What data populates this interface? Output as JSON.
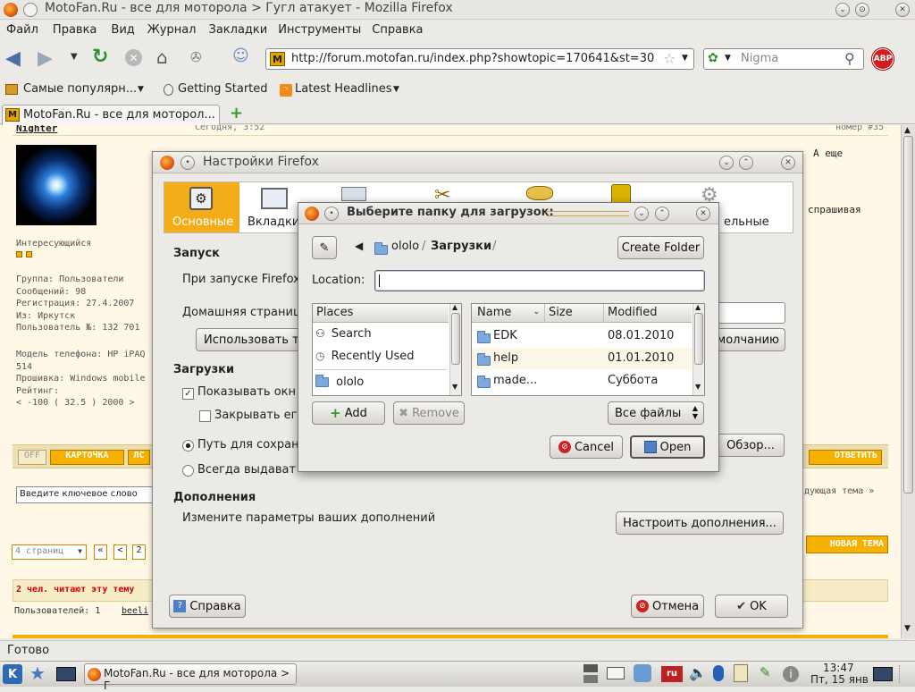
{
  "window_title": "MotoFan.Ru - все для моторола > Гугл атакует - Mozilla Firefox",
  "menu": [
    "Файл",
    "Правка",
    "Вид",
    "Журнал",
    "Закладки",
    "Инструменты",
    "Справка"
  ],
  "url": "http://forum.motofan.ru/index.php?showtopic=170641&st=30",
  "search_placeholder": "Nigma",
  "bookmarks": [
    "Самые популярн...",
    "Getting Started",
    "Latest Headlines"
  ],
  "tab_title": "MotoFan.Ru - все для моторол...",
  "status": "Готово",
  "forum": {
    "user": "Nighter",
    "post_time": "Сегодня, 3:52",
    "post_number": "номер #35",
    "post_text_a": "А еще",
    "post_text_b": "спрашивая",
    "rank": "Интересующийся",
    "info": [
      "Группа: Пользователи",
      "Сообщений: 98",
      "Регистрация: 27.4.2007",
      "Из: Иркутск",
      "Пользователь №: 132 701"
    ],
    "model": "Модель телефона: HP iPAQ 514",
    "firmware": "Прошивка: Windows mobile",
    "rating": "Рейтинг:",
    "rating_value": "< -100 ( 32.5 ) 2000 >",
    "off": "OFF",
    "card": "КАРТОЧКА",
    "pm": "ЛС",
    "reply": "ОТВЕТИТЬ",
    "keyword_input": "Введите ключевое слово",
    "next_topic": "дующая тема »",
    "pages": "4 страниц",
    "page_prev2": "«",
    "page_prev": "<",
    "page_num": "2",
    "new_topic": "НОВАЯ ТЕМА",
    "reading": "2 чел. читают эту тему",
    "users": "Пользователей: 1",
    "users_link": "beeli"
  },
  "prefs": {
    "title": "Настройки Firefox",
    "tabs": [
      "Основные",
      "Вкладки",
      "",
      "",
      "",
      "",
      "ельные"
    ],
    "startup_header": "Запуск",
    "on_start": "При запуске Firefox",
    "home_page": "Домашняя страница",
    "use_current": "Использовать т",
    "default_btn": "молчанию",
    "downloads_header": "Загрузки",
    "show_window": "Показывать окн",
    "close_when": "Закрывать ег",
    "save_path": "Путь для сохран",
    "always_ask": "Всегда выдават",
    "browse": "Обзор...",
    "addons_header": "Дополнения",
    "addons_desc": "Измените параметры ваших дополнений",
    "addons_btn": "Настроить дополнения...",
    "help": "Справка",
    "cancel": "Отмена",
    "ok": "OK"
  },
  "chooser": {
    "title": "Выберите папку для загрузок:",
    "crumbs": [
      "ololo",
      "Загрузки"
    ],
    "create_folder": "Create Folder",
    "location_label": "Location:",
    "location_value": "",
    "places_header": "Places",
    "places": [
      "Search",
      "Recently Used",
      "ololo"
    ],
    "col_name": "Name",
    "col_size": "Size",
    "col_modified": "Modified",
    "files": [
      {
        "name": "EDK",
        "size": "",
        "modified": "08.01.2010"
      },
      {
        "name": "help",
        "size": "",
        "modified": "01.01.2010"
      },
      {
        "name": "made...",
        "size": "",
        "modified": "Суббота"
      }
    ],
    "add": "Add",
    "remove": "Remove",
    "filter": "Все файлы",
    "cancel": "Cancel",
    "open": "Open"
  },
  "taskbar": {
    "task": "MotoFan.Ru - все для моторола > Г",
    "time": "13:47",
    "date": "Пт, 15 янв",
    "lang": "ru"
  }
}
